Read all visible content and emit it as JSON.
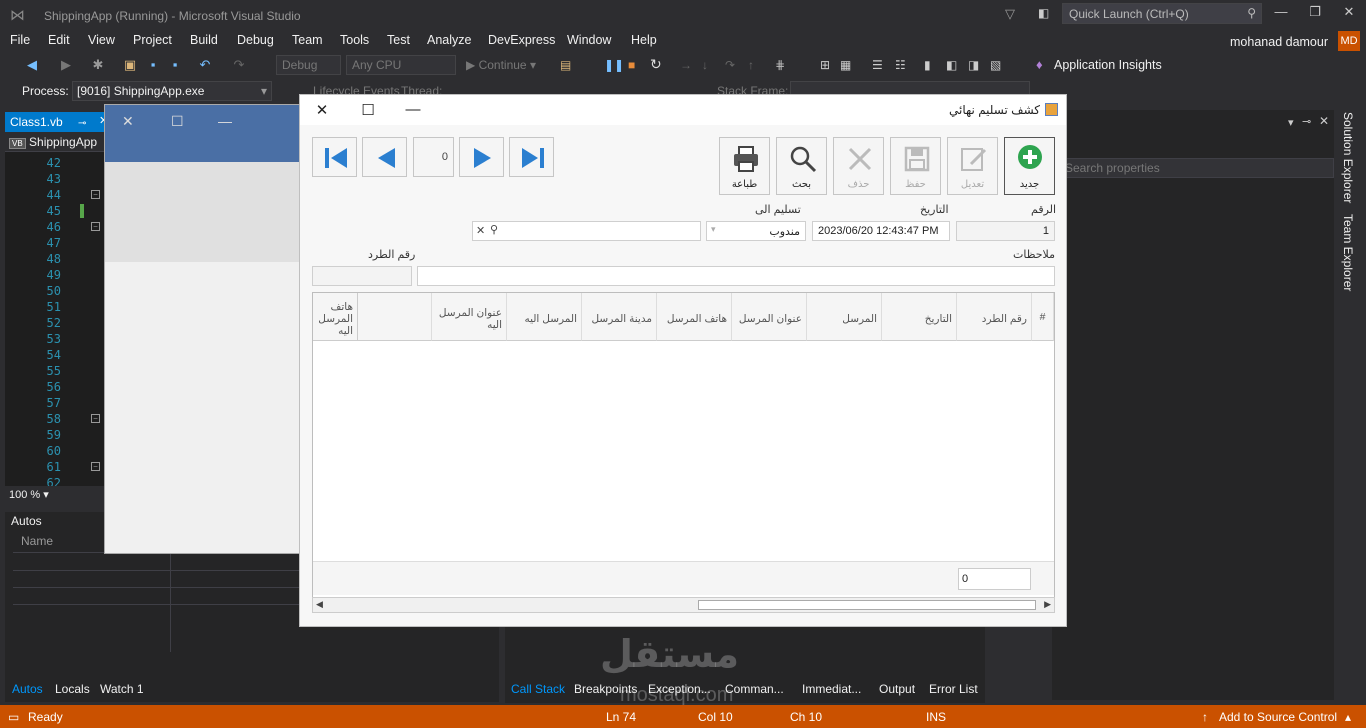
{
  "window": {
    "title": "ShippingApp (Running) - Microsoft Visual Studio",
    "quick_launch_placeholder": "Quick Launch (Ctrl+Q)",
    "user": "mohanad damour",
    "user_initials": "MD"
  },
  "menu": [
    "File",
    "Edit",
    "View",
    "Project",
    "Build",
    "Debug",
    "Team",
    "Tools",
    "Test",
    "Analyze",
    "DevExpress",
    "Window",
    "Help"
  ],
  "toolbar": {
    "config": "Debug",
    "platform": "Any CPU",
    "continue": "Continue",
    "app_insights": "Application Insights",
    "lifecycle": "Lifecycle Events",
    "thread": "Thread:",
    "stack_frame": "Stack Frame:",
    "process_label": "Process:",
    "process_value": "[9016] ShippingApp.exe"
  },
  "editor": {
    "tab": "Class1.vb",
    "project": "ShippingApp",
    "lines": [
      "42",
      "43",
      "44",
      "45",
      "46",
      "47",
      "48",
      "49",
      "50",
      "51",
      "52",
      "53",
      "54",
      "55",
      "56",
      "57",
      "58",
      "59",
      "60",
      "61",
      "62"
    ],
    "zoom": "100 %"
  },
  "autos": {
    "title": "Autos",
    "col_name": "Name",
    "tabs": [
      "Autos",
      "Locals",
      "Watch 1"
    ]
  },
  "bottom_tabs": [
    "Call Stack",
    "Breakpoints",
    "Exception...",
    "Comman...",
    "Immediat...",
    "Output",
    "Error List"
  ],
  "properties": {
    "search_placeholder": "Search properties"
  },
  "side_tabs": [
    "Solution Explorer",
    "Team Explorer"
  ],
  "status": {
    "ready": "Ready",
    "ln": "Ln 74",
    "col": "Col 10",
    "ch": "Ch 10",
    "ins": "INS",
    "source_control": "Add to Source Control"
  },
  "dialog": {
    "title": "كشف تسليم نهائي",
    "record_counter": "0",
    "buttons": {
      "new": "جديد",
      "edit": "تعديل",
      "save": "حفظ",
      "delete": "حذف",
      "search": "بحث",
      "print": "طباعة"
    },
    "fields": {
      "number_label": "الرقم",
      "number_value": "1",
      "date_label": "التاريخ",
      "date_value": "2023/06/20 12:43:47 PM",
      "deliver_to_label": "تسليم الى",
      "deliver_to_value": "مندوب",
      "package_number_label": "رقم الطرد",
      "notes_label": "ملاحظات"
    },
    "grid_columns": [
      "#",
      "رقم الطرد",
      "التاريخ",
      "المرسل",
      "عنوان المرسل",
      "هاتف المرسل",
      "مدينة المرسل",
      "المرسل اليه",
      "عنوان المرسل اليه",
      "هاتف المرسل اليه"
    ],
    "grid_total": "0"
  },
  "watermark": {
    "text": "مستقل",
    "sub": "mostaql.com"
  }
}
